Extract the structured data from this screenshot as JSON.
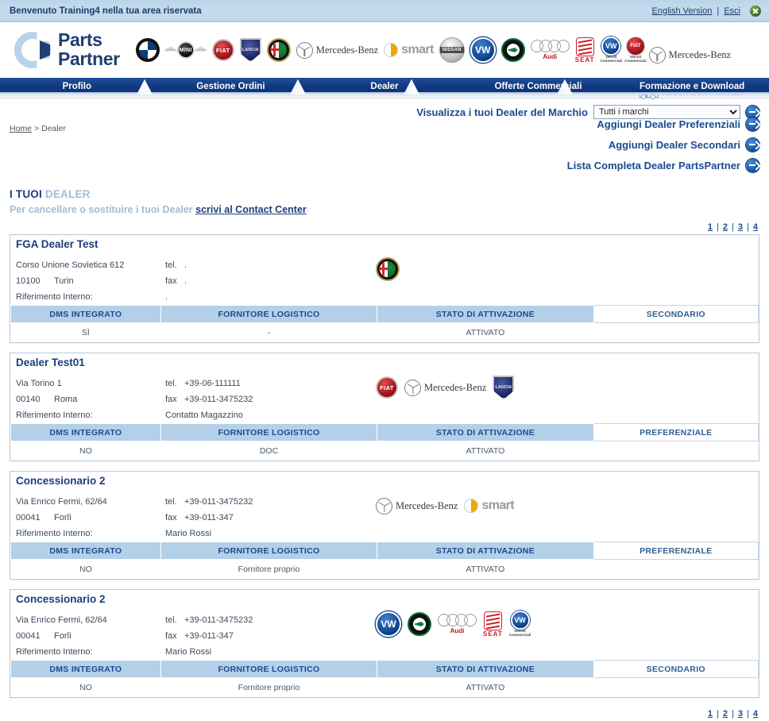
{
  "topbar": {
    "welcome": "Benvenuto Training4 nella tua area riservata",
    "english_link": "English Version",
    "separator": "|",
    "logout_link": "Esci",
    "close_icon": "close-circle-icon"
  },
  "brand": {
    "name_line1": "Parts",
    "name_line2": "Partner",
    "logo_icon": "parts-partner-logo",
    "marques": [
      {
        "id": "bmw",
        "label": "BMW"
      },
      {
        "id": "mini",
        "label": "MINI"
      },
      {
        "id": "fiat",
        "label": "FIAT"
      },
      {
        "id": "lancia",
        "label": "LANCIA"
      },
      {
        "id": "alfa-romeo",
        "label": "Alfa Romeo"
      },
      {
        "id": "mercedes-benz",
        "label": "Mercedes-Benz"
      },
      {
        "id": "smart",
        "label": "smart"
      },
      {
        "id": "nissan",
        "label": "NISSAN"
      },
      {
        "id": "volkswagen",
        "label": "VW"
      },
      {
        "id": "skoda",
        "label": "Skoda"
      },
      {
        "id": "audi",
        "label": "Audi"
      },
      {
        "id": "seat",
        "label": "SEAT"
      },
      {
        "id": "vw-veicoli-commerciali",
        "label": "Veicoli Commerciali"
      },
      {
        "id": "fiat-professional",
        "label": "Veicoli Commerciali"
      },
      {
        "id": "mercedes-benz-vans",
        "label": "Mercedes-Benz"
      }
    ],
    "commercial_band": "Veicoli Commerciali"
  },
  "nav": {
    "items": [
      {
        "id": "profilo",
        "label": "Profilo"
      },
      {
        "id": "gestione-ordini",
        "label": "Gestione Ordini"
      },
      {
        "id": "dealer",
        "label": "Dealer"
      },
      {
        "id": "offerte-commerciali",
        "label": "Offerte Commerciali"
      },
      {
        "id": "formazione-e-download",
        "label": "Formazione e Download"
      }
    ]
  },
  "filter": {
    "label": "Visualizza i tuoi Dealer del Marchio",
    "selected": "Tutti i marchi",
    "options": [
      "Tutti i marchi"
    ],
    "go_icon": "go-arrow-icon"
  },
  "breadcrumb": {
    "home": "Home",
    "separator": ">",
    "current": "Dealer"
  },
  "actions": [
    {
      "id": "aggiungi-dealer-preferenziali",
      "label": "Aggiungi Dealer Preferenziali"
    },
    {
      "id": "aggiungi-dealer-secondari",
      "label": "Aggiungi Dealer Secondari"
    },
    {
      "id": "lista-completa-dealer",
      "label": "Lista Completa Dealer PartsPartner"
    }
  ],
  "section": {
    "title_strong": "I TUOI",
    "title_light": "DEALER",
    "subtitle_text": "Per cancellare o sostituire i tuoi Dealer",
    "subtitle_link": "scrivi al Contact Center"
  },
  "pager": {
    "pages": [
      "1",
      "2",
      "3",
      "4"
    ],
    "separator": "|"
  },
  "table_headers": {
    "dms": "DMS INTEGRATO",
    "fornitore": "FORNITORE LOGISTICO",
    "stato": "STATO DI ATTIVAZIONE"
  },
  "labels": {
    "tel": "tel.",
    "fax": "fax",
    "riferimento": "Riferimento Interno:"
  },
  "dealers": [
    {
      "name": "FGA Dealer Test",
      "address": "Corso Unione Sovietica 612",
      "zip": "10100",
      "city": "Turin",
      "tel": ".",
      "fax": ".",
      "riferimento": ".",
      "marques": [
        "alfa-romeo"
      ],
      "dms": "SÌ",
      "fornitore": "-",
      "stato": "ATTIVATO",
      "tipo": "SECONDARIO"
    },
    {
      "name": "Dealer Test01",
      "address": "Via Torino 1",
      "zip": "00140",
      "city": "Roma",
      "tel": "+39-06-111111",
      "fax": "+39-011-3475232",
      "riferimento": "Contatto Magazzino",
      "marques": [
        "fiat",
        "mercedes-benz",
        "lancia"
      ],
      "dms": "NO",
      "fornitore": "DOC",
      "stato": "ATTIVATO",
      "tipo": "PREFERENZIALE"
    },
    {
      "name": "Concessionario 2",
      "address": "Via Enrico Fermi, 62/64",
      "zip": "00041",
      "city": "Forlì",
      "tel": "+39-011-3475232",
      "fax": "+39-011-347",
      "riferimento": "Mario Rossi",
      "marques": [
        "mercedes-benz",
        "smart"
      ],
      "dms": "NO",
      "fornitore": "Fornitore proprio",
      "stato": "ATTIVATO",
      "tipo": "PREFERENZIALE"
    },
    {
      "name": "Concessionario 2",
      "address": "Via Enrico Fermi, 62/64",
      "zip": "00041",
      "city": "Forlì",
      "tel": "+39-011-3475232",
      "fax": "+39-011-347",
      "riferimento": "Mario Rossi",
      "marques": [
        "volkswagen",
        "skoda",
        "audi",
        "seat",
        "vw-veicoli-commerciali"
      ],
      "dms": "NO",
      "fornitore": "Fornitore proprio",
      "stato": "ATTIVATO",
      "tipo": "SECONDARIO"
    }
  ],
  "colors": {
    "nav_blue": "#133d85",
    "accent_blue": "#1b4a8f",
    "header_cell": "#b3d0e8",
    "topbar": "#bcd6ec"
  }
}
